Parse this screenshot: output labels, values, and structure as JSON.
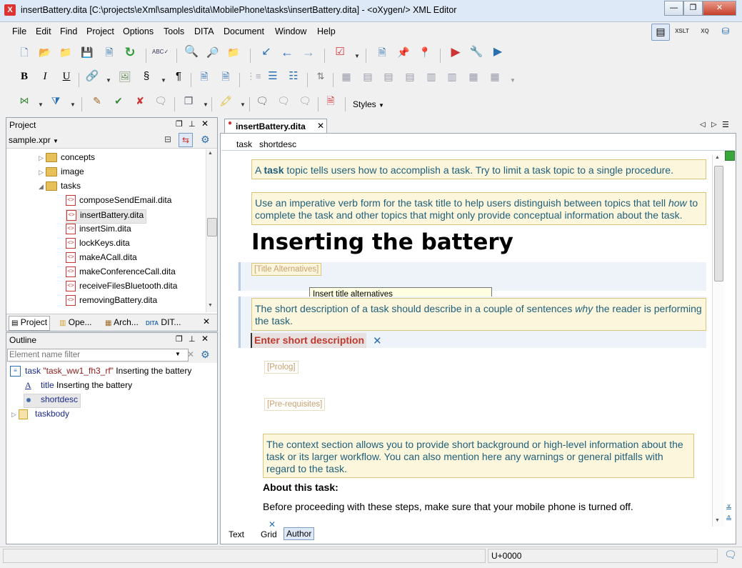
{
  "window": {
    "title": "insertBattery.dita [C:\\projects\\eXml\\samples\\dita\\MobilePhone\\tasks\\insertBattery.dita] - <oXygen/> XML Editor",
    "app_icon_glyph": "X",
    "minimize_glyph": "—",
    "maximize_glyph": "❐",
    "close_glyph": "✕"
  },
  "menu": [
    "File",
    "Edit",
    "Find",
    "Project",
    "Options",
    "Tools",
    "DITA",
    "Document",
    "Window",
    "Help"
  ],
  "toolbar": {
    "xslt_label": "XSLT",
    "xq_label": "XQ",
    "styles_label": "Styles"
  },
  "project_panel": {
    "title": "Project",
    "project_file": "sample.xpr",
    "folders": [
      "concepts",
      "image",
      "tasks"
    ],
    "files": [
      "composeSendEmail.dita",
      "insertBattery.dita",
      "insertSim.dita",
      "lockKeys.dita",
      "makeACall.dita",
      "makeConferenceCall.dita",
      "receiveFilesBluetooth.dita",
      "removingBattery.dita"
    ],
    "tabs": [
      "Project",
      "Ope...",
      "Arch...",
      "DIT..."
    ]
  },
  "outline_panel": {
    "title": "Outline",
    "filter_placeholder": "Element name filter",
    "rows": [
      {
        "element": "task",
        "attr": "\"task_ww1_fh3_rf\"",
        "text": "Inserting the battery"
      },
      {
        "element": "title",
        "attr": "",
        "text": "Inserting the battery"
      },
      {
        "element": "shortdesc",
        "attr": "",
        "text": ""
      },
      {
        "element": "taskbody",
        "attr": "",
        "text": ""
      }
    ]
  },
  "editor": {
    "tab_label": "insertBattery.dita",
    "breadcrumb": [
      "task",
      "shortdesc"
    ],
    "note1_pre": "A ",
    "note1_bold": "task",
    "note1_post": " topic tells users how to accomplish a task. Try to limit a task topic to a single procedure.",
    "note2_pre": "Use an imperative verb form for the task title to help users distinguish between topics that tell ",
    "note2_em": "how",
    "note2_post": " to complete the task and other topics that might only provide conceptual information about the task.",
    "heading": "Inserting the battery",
    "title_alternatives": "[Title Alternatives]",
    "tooltip": "Insert title alternatives",
    "note3_pre": "The short description of a task should describe in a couple of sentences ",
    "note3_em": "why",
    "note3_post": " the reader is performing the task.",
    "short_desc_placeholder": "Enter short description",
    "prolog": "[Prolog]",
    "prereq": "[Pre-requisites]",
    "note4": "The context section allows you to provide short background or high-level information about the task or its larger workflow. You can also mention here any warnings or general pitfalls with regard to the task.",
    "about_heading": "About this task:",
    "about_text": "Before proceeding with these steps, make sure that your mobile phone is turned off.",
    "mode_tabs": [
      "Text",
      "Grid",
      "Author"
    ],
    "active_mode": "Author"
  },
  "status_bar": {
    "unicode": "U+0000"
  },
  "colors": {
    "note_bg": "#fbf6dc",
    "note_text": "#1f5f7a",
    "accent_red": "#c0392b",
    "selection": "#dde9f6"
  }
}
